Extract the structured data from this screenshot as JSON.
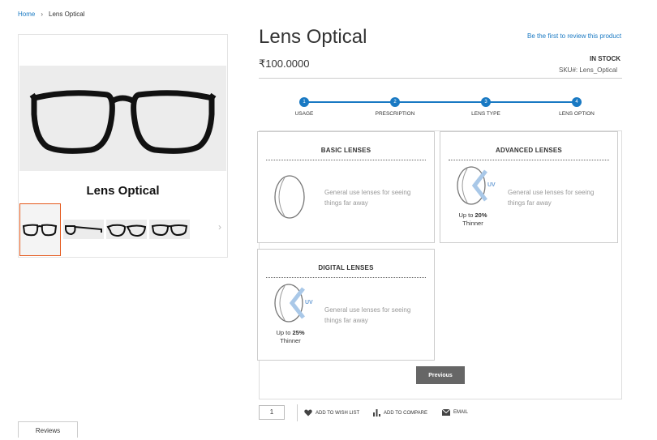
{
  "breadcrumb": {
    "home": "Home",
    "separator": "›",
    "current": "Lens Optical"
  },
  "gallery": {
    "title": "Lens Optical",
    "thumbnail_count": 4,
    "active_index": 0
  },
  "product": {
    "title": "Lens Optical",
    "review_link": "Be the first to review this product",
    "price": "₹100.0000",
    "stock": "IN STOCK",
    "sku_label": "SKU#:",
    "sku_value": "Lens_Optical"
  },
  "steps": [
    {
      "number": "1",
      "label": "USAGE"
    },
    {
      "number": "2",
      "label": "PRESCRIPTION"
    },
    {
      "number": "3",
      "label": "LENS TYPE"
    },
    {
      "number": "4",
      "label": "LENS OPTION"
    }
  ],
  "lens_options": [
    {
      "title": "BASIC LENSES",
      "description_line1": "General use lenses for seeing",
      "description_line2": "things far away"
    },
    {
      "title": "ADVANCED LENSES",
      "description_line1": "General use lenses for seeing",
      "description_line2": "things far away",
      "thin_prefix": "Up to",
      "thin_value": "20%",
      "thin_suffix": "Thinner",
      "uv_label": "UV"
    },
    {
      "title": "DIGITAL LENSES",
      "description_line1": "General use lenses for seeing",
      "description_line2": "things far away",
      "thin_prefix": "Up to",
      "thin_value": "25%",
      "thin_suffix": "Thinner",
      "uv_label": "UV"
    }
  ],
  "buttons": {
    "previous": "Previous"
  },
  "actions": {
    "quantity": "1",
    "wishlist": "ADD TO WISH LIST",
    "compare": "ADD TO COMPARE",
    "email": "EMAIL"
  },
  "tabs": {
    "reviews": "Reviews"
  },
  "colors": {
    "accent": "#1979c3",
    "active_thumb_border": "#e4581c",
    "button_bg": "#666666"
  }
}
